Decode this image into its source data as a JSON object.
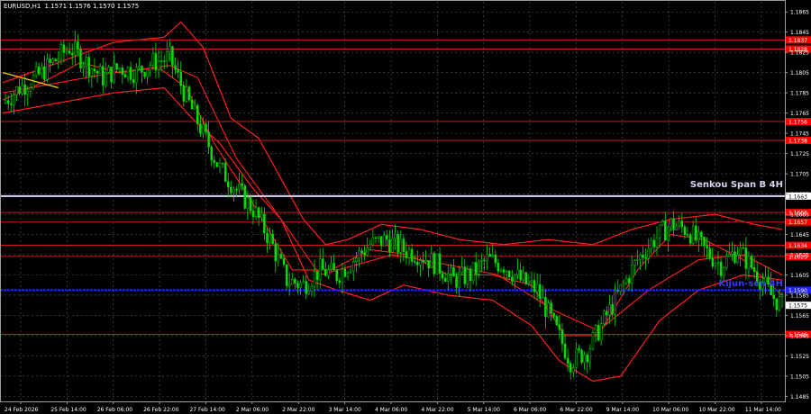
{
  "header": {
    "symbol": "EURUSD,H1",
    "quote": "1.1571 1.1576 1.1570 1.1575"
  },
  "colors": {
    "background": "#000000",
    "grid": "#5a5a5a",
    "bull_candle": "#00dd00",
    "bear_candle": "#00dd00",
    "ichimoku_cloud": "#ff2020",
    "level_lines": "#cc1a1a",
    "senkou_line": "#d9d2f2",
    "kijun_line": "#1f1fff",
    "tenkan_yellow": "#f0d000",
    "price_label_bg": "#ff0000"
  },
  "labels": {
    "senkou": "Senkou Span B 4H",
    "kijun": "Kijun-sen 4H"
  },
  "chart_data": {
    "type": "candlestick",
    "ylim": [
      1.148,
      1.1875
    ],
    "y_ticks": [
      "1.1865",
      "1.1845",
      "1.1825",
      "1.1805",
      "1.1785",
      "1.1765",
      "1.1745",
      "1.1725",
      "1.1705",
      "1.1685",
      "1.1665",
      "1.1645",
      "1.1625",
      "1.1605",
      "1.1585",
      "1.1565",
      "1.1545",
      "1.1525",
      "1.1505",
      "1.1485"
    ],
    "x_ticks": [
      "24 Feb 2026",
      "25 Feb 14:00",
      "26 Feb 06:00",
      "26 Feb 22:00",
      "27 Feb 14:00",
      "2 Mar 06:00",
      "2 Mar 22:00",
      "3 Mar 14:00",
      "4 Mar 06:00",
      "4 Mar 22:00",
      "5 Mar 14:00",
      "6 Mar 06:00",
      "6 Mar 22:00",
      "9 Mar 14:00",
      "10 Mar 06:00",
      "10 Mar 22:00",
      "11 Mar 14:00"
    ],
    "close_anchors": [
      [
        0,
        1.1775
      ],
      [
        6,
        1.179
      ],
      [
        12,
        1.18
      ],
      [
        18,
        1.1815
      ],
      [
        24,
        1.183
      ],
      [
        30,
        1.1815
      ],
      [
        36,
        1.18
      ],
      [
        42,
        1.181
      ],
      [
        48,
        1.1805
      ],
      [
        54,
        1.1815
      ],
      [
        60,
        1.182
      ],
      [
        66,
        1.178
      ],
      [
        72,
        1.1745
      ],
      [
        78,
        1.171
      ],
      [
        84,
        1.169
      ],
      [
        90,
        1.167
      ],
      [
        96,
        1.164
      ],
      [
        102,
        1.16
      ],
      [
        108,
        1.1595
      ],
      [
        114,
        1.161
      ],
      [
        120,
        1.1605
      ],
      [
        126,
        1.162
      ],
      [
        132,
        1.1635
      ],
      [
        138,
        1.164
      ],
      [
        144,
        1.163
      ],
      [
        150,
        1.1625
      ],
      [
        156,
        1.1615
      ],
      [
        162,
        1.16
      ],
      [
        168,
        1.1605
      ],
      [
        174,
        1.162
      ],
      [
        180,
        1.1615
      ],
      [
        186,
        1.16
      ],
      [
        192,
        1.159
      ],
      [
        198,
        1.1555
      ],
      [
        204,
        1.152
      ],
      [
        210,
        1.153
      ],
      [
        216,
        1.156
      ],
      [
        222,
        1.159
      ],
      [
        228,
        1.162
      ],
      [
        234,
        1.164
      ],
      [
        240,
        1.1655
      ],
      [
        246,
        1.165
      ],
      [
        252,
        1.163
      ],
      [
        258,
        1.1615
      ],
      [
        264,
        1.163
      ],
      [
        270,
        1.161
      ],
      [
        276,
        1.1585
      ],
      [
        280,
        1.1575
      ]
    ],
    "tenkan_anchors": [
      [
        0,
        1.1778
      ],
      [
        14,
        1.1795
      ],
      [
        28,
        1.1815
      ],
      [
        42,
        1.1805
      ],
      [
        56,
        1.181
      ],
      [
        66,
        1.179
      ],
      [
        76,
        1.1735
      ],
      [
        90,
        1.1675
      ],
      [
        104,
        1.161
      ],
      [
        118,
        1.161
      ],
      [
        132,
        1.163
      ],
      [
        146,
        1.1625
      ],
      [
        160,
        1.1605
      ],
      [
        176,
        1.1605
      ],
      [
        190,
        1.1595
      ],
      [
        202,
        1.1545
      ],
      [
        214,
        1.1545
      ],
      [
        228,
        1.161
      ],
      [
        240,
        1.1645
      ],
      [
        252,
        1.164
      ],
      [
        266,
        1.162
      ],
      [
        280,
        1.1585
      ]
    ],
    "kijun_anchors": [
      [
        0,
        1.1785
      ],
      [
        20,
        1.1795
      ],
      [
        40,
        1.1805
      ],
      [
        60,
        1.1812
      ],
      [
        70,
        1.18
      ],
      [
        84,
        1.172
      ],
      [
        100,
        1.166
      ],
      [
        114,
        1.1605
      ],
      [
        140,
        1.1625
      ],
      [
        160,
        1.1615
      ],
      [
        178,
        1.1605
      ],
      [
        198,
        1.157
      ],
      [
        214,
        1.155
      ],
      [
        232,
        1.159
      ],
      [
        250,
        1.162
      ],
      [
        266,
        1.1625
      ],
      [
        280,
        1.1605
      ]
    ],
    "cloud_upper": [
      [
        0,
        1.1795
      ],
      [
        20,
        1.1815
      ],
      [
        40,
        1.1835
      ],
      [
        58,
        1.184
      ],
      [
        64,
        1.1855
      ],
      [
        72,
        1.183
      ],
      [
        82,
        1.176
      ],
      [
        92,
        1.174
      ],
      [
        100,
        1.17
      ],
      [
        108,
        1.166
      ],
      [
        116,
        1.1635
      ],
      [
        124,
        1.164
      ],
      [
        136,
        1.1655
      ],
      [
        150,
        1.165
      ],
      [
        164,
        1.164
      ],
      [
        180,
        1.1635
      ],
      [
        196,
        1.164
      ],
      [
        212,
        1.1635
      ],
      [
        226,
        1.165
      ],
      [
        240,
        1.166
      ],
      [
        256,
        1.1665
      ],
      [
        270,
        1.1655
      ],
      [
        280,
        1.165
      ]
    ],
    "cloud_lower": [
      [
        0,
        1.1765
      ],
      [
        20,
        1.1775
      ],
      [
        40,
        1.1785
      ],
      [
        58,
        1.179
      ],
      [
        68,
        1.176
      ],
      [
        78,
        1.1735
      ],
      [
        90,
        1.169
      ],
      [
        100,
        1.166
      ],
      [
        110,
        1.16
      ],
      [
        120,
        1.159
      ],
      [
        132,
        1.158
      ],
      [
        144,
        1.1595
      ],
      [
        160,
        1.1585
      ],
      [
        176,
        1.158
      ],
      [
        190,
        1.1555
      ],
      [
        200,
        1.152
      ],
      [
        212,
        1.15
      ],
      [
        222,
        1.1505
      ],
      [
        236,
        1.156
      ],
      [
        250,
        1.159
      ],
      [
        266,
        1.1605
      ],
      [
        280,
        1.16
      ]
    ],
    "yellow_segment": [
      [
        0,
        1.1805
      ],
      [
        20,
        1.179
      ]
    ],
    "levels": [
      {
        "value": 1.18373,
        "label": "1.1837"
      },
      {
        "value": 1.18283,
        "label": "1.1828"
      },
      {
        "value": 1.17567,
        "label": "1.1756"
      },
      {
        "value": 1.1738,
        "label": "1.1738"
      },
      {
        "value": 1.16667,
        "label": "1.1666"
      },
      {
        "value": 1.16573,
        "label": "1.1657"
      },
      {
        "value": 1.16343,
        "label": "1.1634"
      },
      {
        "value": 1.16233,
        "label": "1.1623"
      },
      {
        "value": 1.15463,
        "label": "1.1546"
      }
    ],
    "senkou_value": 1.1683,
    "senkou_label": "1.1683",
    "kijun_value": 1.159,
    "kijun_label": "1.1590",
    "last_price": 1.1575,
    "last_price_label": "1.1575"
  }
}
